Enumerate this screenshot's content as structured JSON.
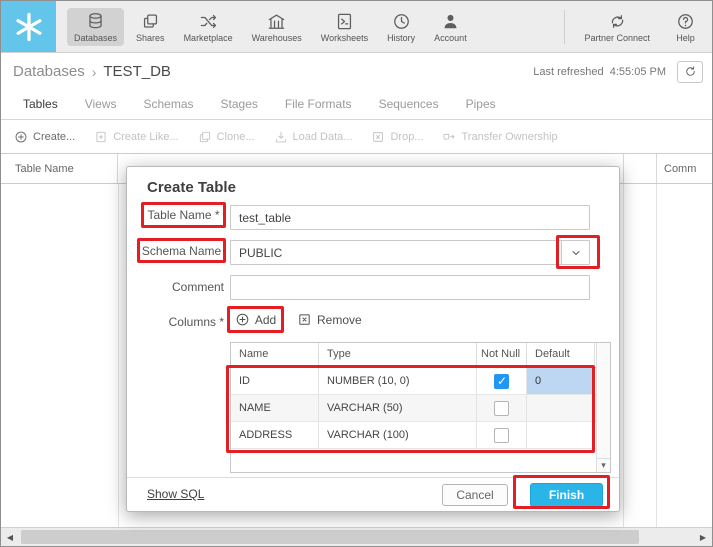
{
  "colors": {
    "brand": "#29b5e8",
    "logo_background": "#63c5ea",
    "annotation_red": "#e31e24",
    "checkbox_checked": "#2196f3",
    "selected_cell": "#bdd7f2"
  },
  "nav": {
    "items": [
      {
        "label": "Databases",
        "icon": "database-icon",
        "active": true
      },
      {
        "label": "Shares",
        "icon": "shares-icon"
      },
      {
        "label": "Marketplace",
        "icon": "marketplace-icon"
      },
      {
        "label": "Warehouses",
        "icon": "warehouses-icon"
      },
      {
        "label": "Worksheets",
        "icon": "worksheets-icon"
      },
      {
        "label": "History",
        "icon": "history-icon"
      },
      {
        "label": "Account",
        "icon": "account-icon"
      },
      {
        "label": "Partner Connect",
        "icon": "partner-connect-icon"
      },
      {
        "label": "Help",
        "icon": "help-icon"
      }
    ]
  },
  "breadcrumb": {
    "root": "Databases",
    "separator": "›",
    "current": "TEST_DB",
    "refreshed_label": "Last refreshed",
    "refreshed_time": "4:55:05 PM"
  },
  "tabs": [
    {
      "label": "Tables",
      "active": true
    },
    {
      "label": "Views"
    },
    {
      "label": "Schemas"
    },
    {
      "label": "Stages"
    },
    {
      "label": "File Formats"
    },
    {
      "label": "Sequences"
    },
    {
      "label": "Pipes"
    }
  ],
  "toolbar": {
    "items": [
      {
        "label": "Create...",
        "icon": "plus-circle-icon",
        "disabled": false
      },
      {
        "label": "Create Like...",
        "icon": "create-like-icon",
        "disabled": true
      },
      {
        "label": "Clone...",
        "icon": "clone-icon",
        "disabled": true
      },
      {
        "label": "Load Data...",
        "icon": "load-data-icon",
        "disabled": true
      },
      {
        "label": "Drop...",
        "icon": "drop-icon",
        "disabled": true
      },
      {
        "label": "Transfer Ownership",
        "icon": "transfer-ownership-icon",
        "disabled": true
      }
    ]
  },
  "list_header": {
    "first_column": "Table Name",
    "last_column": "Comm"
  },
  "modal": {
    "title": "Create Table",
    "table_name": {
      "label": "Table Name *",
      "value": "test_table"
    },
    "schema_name": {
      "label": "Schema Name",
      "value": "PUBLIC"
    },
    "comment": {
      "label": "Comment",
      "value": ""
    },
    "columns": {
      "label": "Columns *",
      "add_label": "Add",
      "remove_label": "Remove",
      "headers": [
        "Name",
        "Type",
        "Not Null",
        "Default"
      ],
      "rows": [
        {
          "name": "ID",
          "type": "NUMBER (10, 0)",
          "not_null": true,
          "default": "0",
          "default_selected": true
        },
        {
          "name": "NAME",
          "type": "VARCHAR (50)",
          "not_null": false,
          "default": ""
        },
        {
          "name": "ADDRESS",
          "type": "VARCHAR (100)",
          "not_null": false,
          "default": ""
        }
      ]
    },
    "footer": {
      "show_sql": "Show SQL",
      "cancel": "Cancel",
      "finish": "Finish"
    }
  }
}
